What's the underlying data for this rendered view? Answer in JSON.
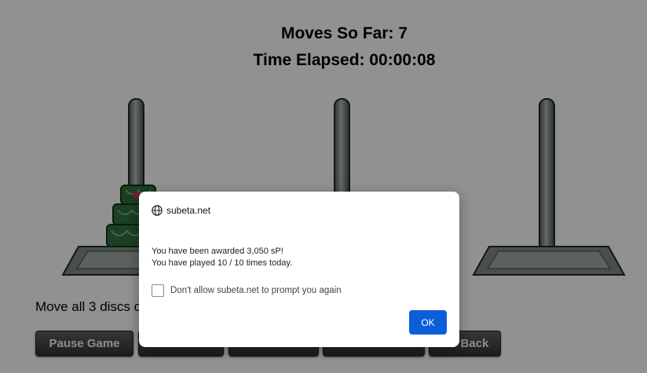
{
  "game": {
    "moves_label": "Moves So Far: 7",
    "time_label": "Time Elapsed: 00:00:08",
    "instructions": "Move all 3 discs c",
    "pegs": [
      {
        "name": "left",
        "discs": 3
      },
      {
        "name": "middle",
        "discs": 0
      },
      {
        "name": "right",
        "discs": 0
      }
    ],
    "buttons": {
      "pause": "Pause Game",
      "back": "Go Back"
    }
  },
  "dialog": {
    "origin": "subeta.net",
    "message_line1": "You have been awarded 3,050 sP!",
    "message_line2": "You have played 10 / 10 times today.",
    "checkbox_label": "Don't allow subeta.net to prompt you again",
    "ok_label": "OK"
  },
  "colors": {
    "overlay": "#000000",
    "ok_button": "#0b5ed7",
    "disc_green": "#2e6b3a"
  }
}
